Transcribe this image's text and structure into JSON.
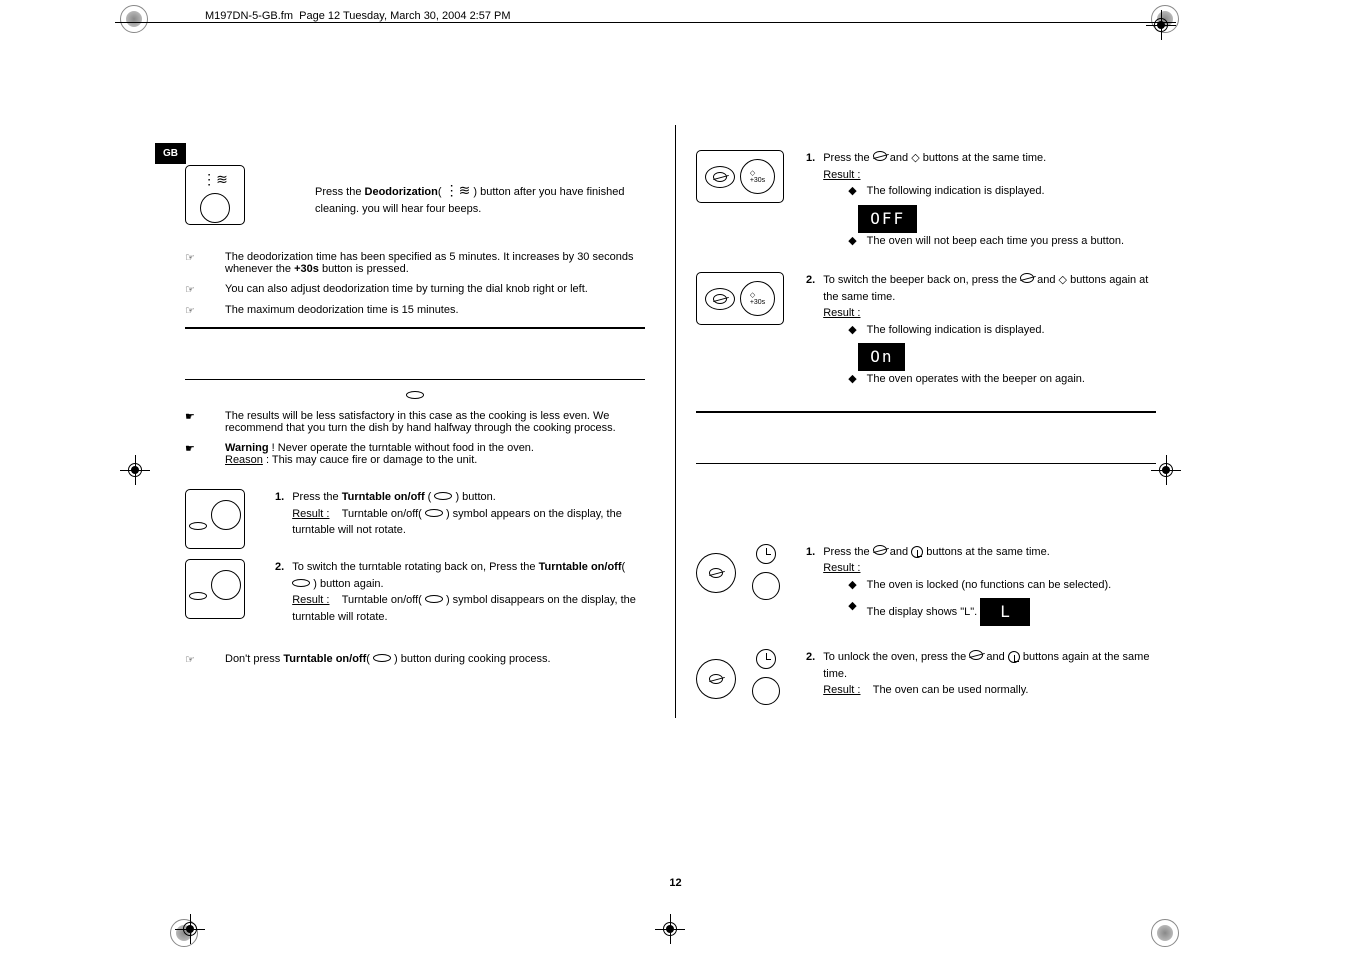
{
  "header": {
    "filename": "M197DN-5-GB.fm",
    "pageinfo": "Page 12  Tuesday, March 30, 2004  2:57 PM"
  },
  "tab": "GB",
  "pageNumber": "12",
  "left": {
    "deodor": {
      "intro1": "Press the ",
      "introBold": "Deodorization",
      "intro2": "( ",
      "intro3": " ) button after you have finished cleaning. you will hear four beeps.",
      "note1a": "The deodorization time has been specified as 5 minutes. It increases by 30 seconds whenever the ",
      "note1bold": "+30s",
      "note1b": " button is pressed.",
      "note2": "You can also adjust deodorization time by turning the dial knob right or left.",
      "note3": "The maximum deodorization time is 15 minutes."
    },
    "turntable": {
      "tip1": "The results will be less satisfactory in this case as the cooking is less even. We recommend that you turn the dish by hand halfway through the cooking process.",
      "tip2a": "Warning",
      "tip2b": " ! Never operate the turntable without food in the oven.",
      "reasonLabel": "Reason",
      "tip2c": " : This may cauce fire or damage to the unit.",
      "step1a": "Press the ",
      "step1bold": "Turntable on/off",
      "step1b": " ( ",
      "step1c": " ) button.",
      "step1resultLabel": "Result :",
      "step1result": "Turntable on/off( ",
      "step1result2": " ) symbol appears on the display, the turntable will not rotate.",
      "step2a": "To switch the turntable rotating back on, Press the ",
      "step2bold": "Turntable on/off",
      "step2b": "( ",
      "step2c": " ) button again.",
      "step2resultLabel": "Result :",
      "step2result": "Turntable on/off( ",
      "step2result2": " ) symbol disappears on the display, the turntable will rotate.",
      "footnote1": "Don't press ",
      "footnoteBold": "Turntable on/off",
      "footnote2": "( ",
      "footnote3": " ) button during cooking process."
    }
  },
  "right": {
    "beeper": {
      "step1a": "Press the ",
      "step1b": " and ",
      "step1c": " buttons at the same time.",
      "resultLabel": "Result :",
      "bullet1": "The following indication is displayed.",
      "display1": "OFF",
      "bullet2": "The oven will not beep each time you press a button.",
      "step2a": "To switch the beeper back on, press the ",
      "step2b": " and ",
      "step2c": " buttons again at the same time.",
      "bullet3": "The following indication is displayed.",
      "display2": "On",
      "bullet4": "The oven operates with the beeper on again."
    },
    "lock": {
      "step1a": "Press the ",
      "step1b": " and ",
      "step1c": " buttons at the same time.",
      "resultLabel": "Result :",
      "bullet1": "The oven is locked (no functions can be selected).",
      "bullet2": "The display shows \"L\".",
      "display1": "L",
      "step2a": "To unlock the oven, press the ",
      "step2b": " and ",
      "step2c": " buttons again at the same time.",
      "step2resultLabel": "Result :",
      "step2result": "The oven can be used normally."
    }
  }
}
